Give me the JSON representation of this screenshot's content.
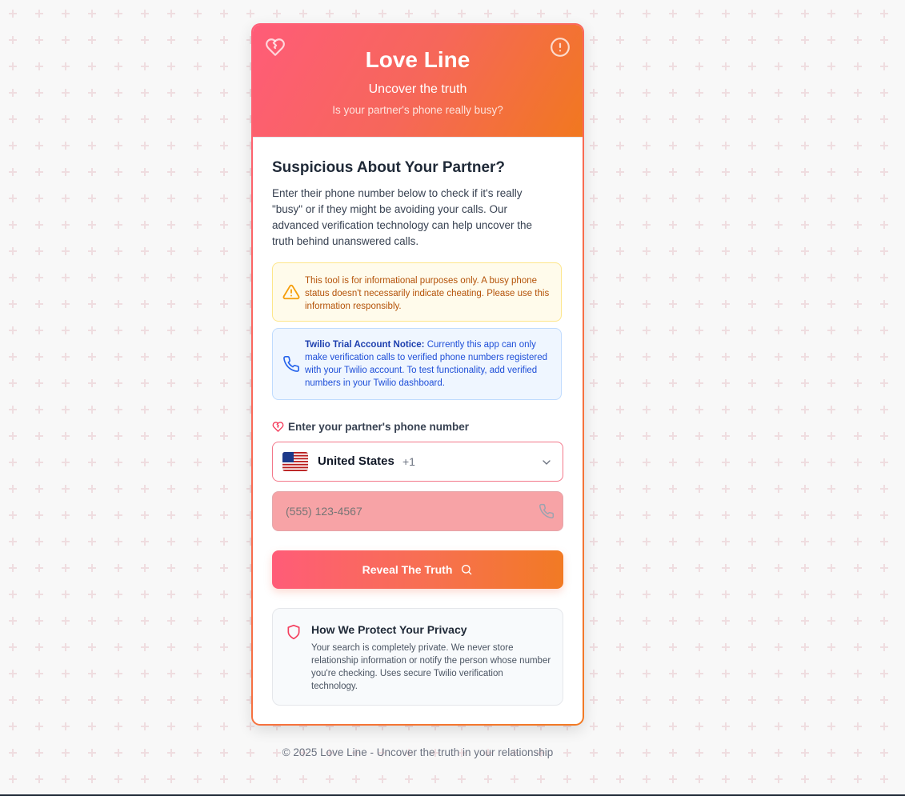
{
  "app": {
    "title": "Love Line",
    "subtitle": "Uncover the truth",
    "tagline": "Is your partner's phone really busy?"
  },
  "colors": {
    "accent_start": "#ff5c78",
    "accent_end": "#f27a24",
    "warning_text": "#b45309",
    "info_text": "#1d4ed8"
  },
  "icons": {
    "header_left": "broken-heart-icon",
    "header_right": "alert-circle-icon",
    "warning": "warning-triangle-icon",
    "info": "phone-icon",
    "label": "heart-icon",
    "dropdown": "chevron-down-icon",
    "input": "phone-icon",
    "button": "search-icon",
    "privacy": "shield-icon"
  },
  "intro": {
    "heading": "Suspicious About Your Partner?",
    "description": "Enter their phone number below to check if it's really \"busy\" or if they might be avoiding your calls. Our advanced verification technology can help uncover the truth behind unanswered calls."
  },
  "warning_notice": {
    "text": "This tool is for informational purposes only. A busy phone status doesn't necessarily indicate cheating. Please use this information responsibly."
  },
  "trial_notice": {
    "heading": "Twilio Trial Account Notice:",
    "text": " Currently this app can only make verification calls to verified phone numbers registered with your Twilio account. To test functionality, add verified numbers in your Twilio dashboard."
  },
  "form": {
    "label": "Enter your partner's phone number",
    "country": {
      "name": "United States",
      "code": "+1"
    },
    "phone": {
      "value": "",
      "placeholder": "(555) 123-4567"
    },
    "submit_label": "Reveal The Truth"
  },
  "privacy": {
    "title": "How We Protect Your Privacy",
    "text": "Your search is completely private. We never store relationship information or notify the person whose number you're checking. Uses secure Twilio verification technology."
  },
  "footer": {
    "text": "© 2025 Love Line - Uncover the truth in your relationship"
  }
}
